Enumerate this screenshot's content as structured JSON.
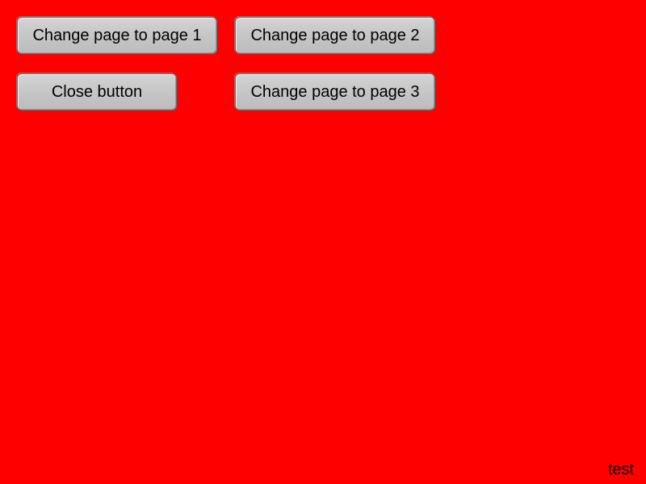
{
  "theme": {
    "background_color": "#ff0000",
    "button_color": "#c8c8c8",
    "text_color": "#000000"
  },
  "buttons": {
    "page1": "Change page to page 1",
    "page2": "Change page to page 2",
    "close": "Close button",
    "page3": "Change page to page 3"
  },
  "footer": {
    "label": "test"
  }
}
